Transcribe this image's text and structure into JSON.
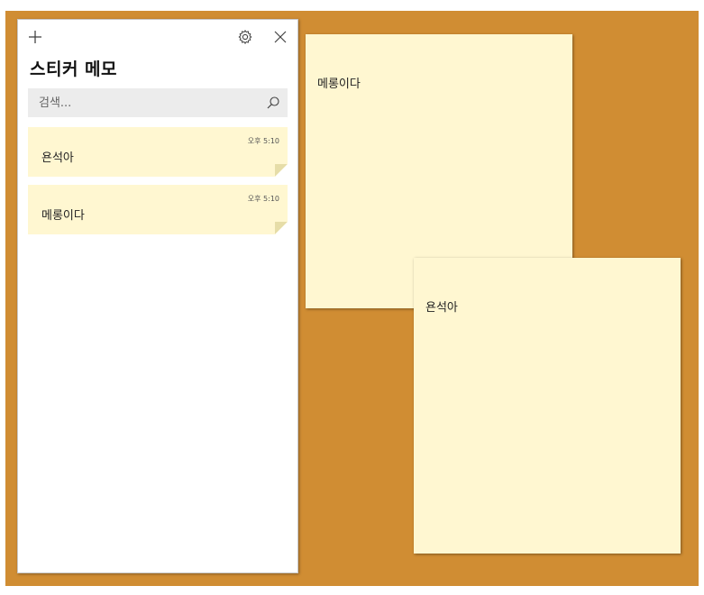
{
  "app": {
    "title": "스티커 메모",
    "search_placeholder": "검색..."
  },
  "toolbar": {
    "add_icon": "plus-icon",
    "settings_icon": "gear-icon",
    "close_icon": "close-icon"
  },
  "notes_list": [
    {
      "time": "오후 5:10",
      "text": "욘석아"
    },
    {
      "time": "오후 5:10",
      "text": "메롱이다"
    }
  ],
  "open_notes": [
    {
      "text": "메롱이다"
    },
    {
      "text": "욘석아"
    }
  ],
  "colors": {
    "desktop_background": "#d08d33",
    "note_yellow": "#fff7d1",
    "search_background": "#ececec"
  }
}
